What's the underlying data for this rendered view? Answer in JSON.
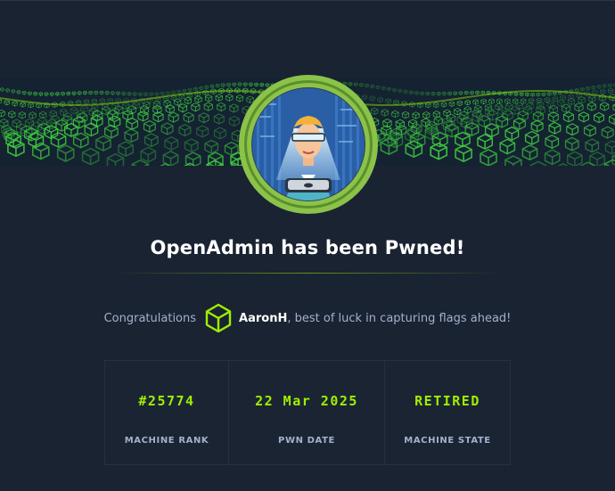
{
  "title": "OpenAdmin has been Pwned!",
  "congrats": {
    "prefix": "Congratulations",
    "user_icon": "htb-cube-icon",
    "username": "AaronH",
    "suffix": ", best of luck in capturing flags ahead!"
  },
  "avatar": {
    "icon": "openadmin-machine-avatar",
    "ring_color": "#8bc34a"
  },
  "stats": [
    {
      "value": "#25774",
      "label": "MACHINE RANK"
    },
    {
      "value": "22 Mar 2025",
      "label": "PWN DATE"
    },
    {
      "value": "RETIRED",
      "label": "MACHINE STATE"
    }
  ],
  "colors": {
    "background": "#1a2332",
    "accent": "#9fef00",
    "muted_text": "#a4b1cd",
    "title_text": "#ffffff"
  }
}
